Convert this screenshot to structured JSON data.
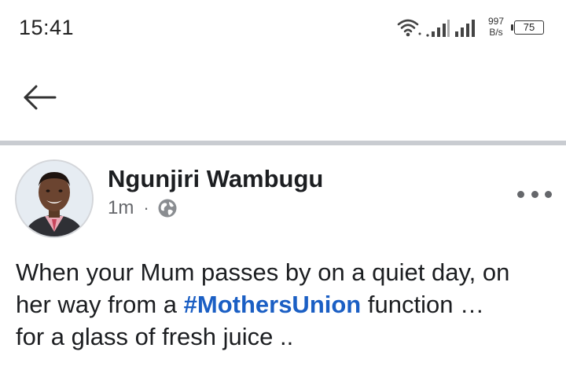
{
  "status_bar": {
    "time": "15:41",
    "net_speed_value": "997",
    "net_speed_unit": "B/s",
    "battery": "75",
    "icons": [
      "wifi-icon",
      "signal-icon",
      "signal-icon",
      "battery-icon"
    ]
  },
  "app_bar": {
    "back_icon": "arrow-left-icon"
  },
  "post": {
    "author": "Ngunjiri Wambugu",
    "time_ago": "1m",
    "separator": "·",
    "privacy_icon": "globe-icon",
    "more_icon": "more-dots-icon",
    "text_line1": "When your Mum passes by on a quiet day, on",
    "text_line2_prefix": "her way from a ",
    "hashtag": "#MothersUnion",
    "text_line2_suffix": " function …",
    "text_line3": "for  a glass of fresh juice .."
  },
  "colors": {
    "hashtag": "#1b5fc4",
    "divider": "#c9ccd1",
    "meta": "#65676b"
  }
}
